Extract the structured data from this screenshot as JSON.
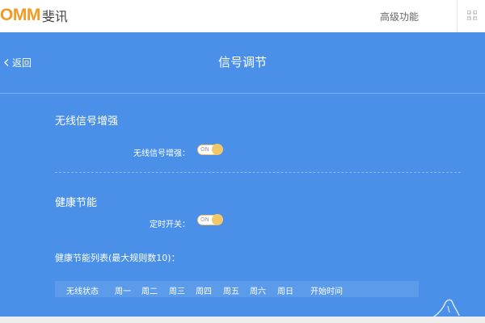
{
  "header": {
    "logo_mark": "OMM",
    "logo_text": "斐讯",
    "advanced_label": "高级功能",
    "menu_icon": "grid-icon"
  },
  "page": {
    "back_label": "返回",
    "back_icon": "chevron-left-icon",
    "title": "信号调节"
  },
  "wireless": {
    "section_title": "无线信号增强",
    "toggle_label": "无线信号增强：",
    "toggle_state": "ON"
  },
  "health": {
    "section_title": "健康节能",
    "timer_label": "定时开关：",
    "timer_state": "ON",
    "list_title": "健康节能列表(最大规则数10)：",
    "columns": [
      "无线状态",
      "周一",
      "周二",
      "周三",
      "周四",
      "周五",
      "周六",
      "周日",
      "开始时间"
    ]
  },
  "colors": {
    "panel_bg": "#4a90e8",
    "brand_orange": "#f29a21",
    "toggle_on": "#f1c76a"
  }
}
